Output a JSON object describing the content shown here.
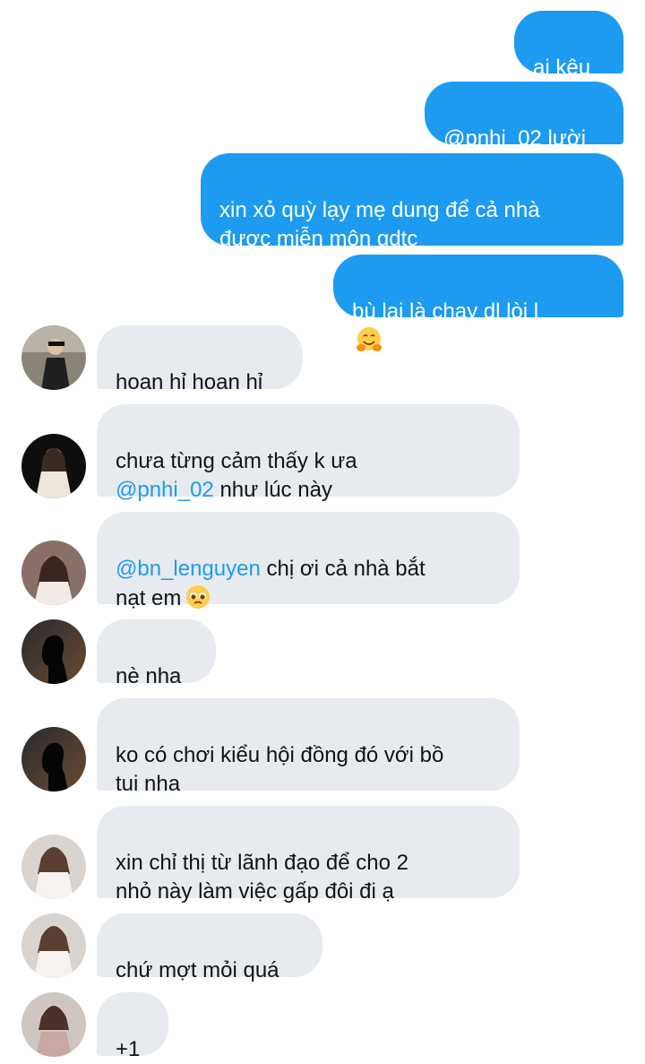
{
  "messages_out": [
    {
      "text": "ai kêu"
    },
    {
      "text": "@pnhi_02 lười"
    },
    {
      "text": "xin xỏ quỳ lạy mẹ dung để cả nhà\nđược miễn môn gdtc"
    },
    {
      "text": "bù lại là chạy dl lòi l",
      "emoji": "hugging-face"
    }
  ],
  "messages_in": [
    {
      "text": "hoan hỉ hoan hỉ",
      "avatar": "avatar-photo"
    },
    {
      "mention": "@pnhi_02",
      "pre": "chưa từng cảm thấy k ưa\n",
      "post": " như lúc này",
      "avatar": "avatar-photo"
    },
    {
      "mention": "@bn_lenguyen",
      "post": " chị ơi cả nhà bắt\nnạt em",
      "emoji": "pleading-face",
      "avatar": "avatar-photo"
    },
    {
      "text": "nè nha",
      "avatar": "avatar-silhouette"
    },
    {
      "text": "ko có chơi kiểu hội đồng đó với bồ\ntui nha",
      "avatar": "avatar-silhouette"
    },
    {
      "text": "xin chỉ thị từ lãnh đạo để cho 2\nnhỏ này làm việc gấp đôi đi ạ",
      "avatar": "avatar-photo"
    },
    {
      "text": "chứ mợt mỏi quá",
      "avatar": "avatar-photo"
    },
    {
      "text": "+1",
      "avatar": "avatar-photo"
    }
  ],
  "colors": {
    "outgoing_bubble": "#1d9bf0",
    "incoming_bubble": "#e7ebef",
    "mention": "#1d9bf0"
  }
}
